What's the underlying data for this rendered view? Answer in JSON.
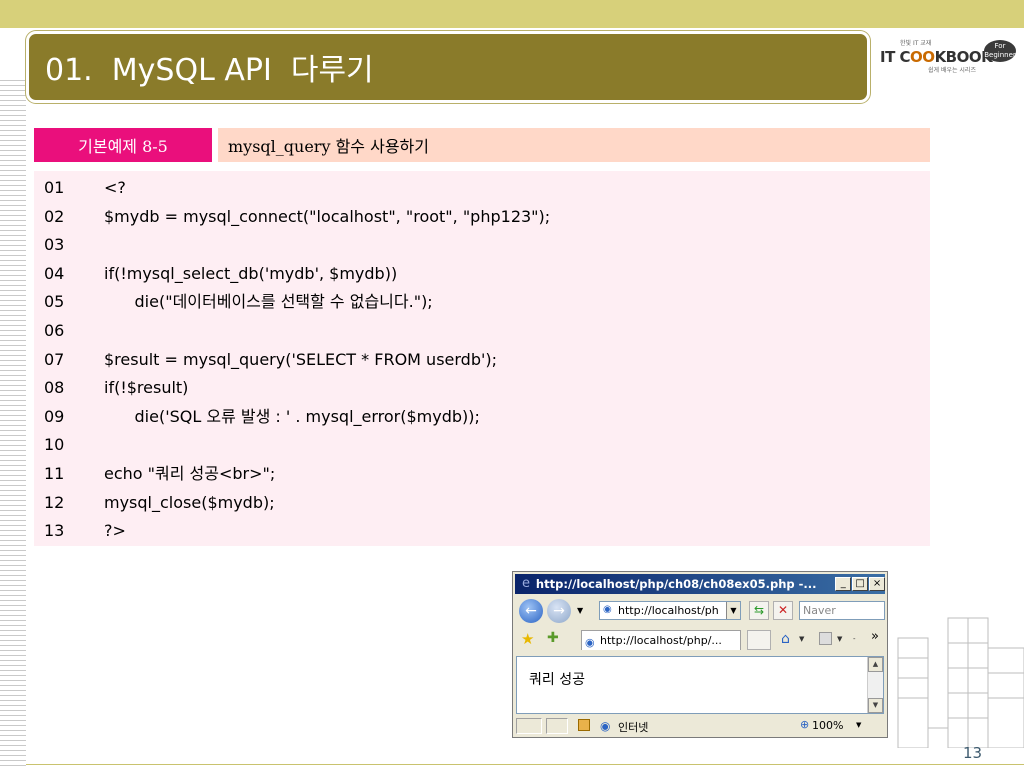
{
  "slide": {
    "title": "01.  MySQL API  다루기",
    "page_number": "13"
  },
  "logo": {
    "brand_prefix": "IT C",
    "brand_oo": "OO",
    "brand_suffix": "KBOOK",
    "tagline": "한빛 IT 교재",
    "sub": "쉽게 배우는 시리즈",
    "badge": "For Beginner"
  },
  "example": {
    "label": "기본예제 8-5",
    "title": "mysql_query 함수 사용하기"
  },
  "code_lines": [
    {
      "no": "01",
      "code": "<?"
    },
    {
      "no": "02",
      "code": "$mydb = mysql_connect(\"localhost\", \"root\", \"php123\");"
    },
    {
      "no": "03",
      "code": ""
    },
    {
      "no": "04",
      "code": "if(!mysql_select_db('mydb', $mydb))"
    },
    {
      "no": "05",
      "code": "      die(\"데이터베이스를 선택할 수 없습니다.\");"
    },
    {
      "no": "06",
      "code": ""
    },
    {
      "no": "07",
      "code": "$result = mysql_query('SELECT * FROM userdb');"
    },
    {
      "no": "08",
      "code": "if(!$result)"
    },
    {
      "no": "09",
      "code": "      die('SQL 오류 발생 : ' . mysql_error($mydb));"
    },
    {
      "no": "10",
      "code": ""
    },
    {
      "no": "11",
      "code": "echo \"쿼리 성공<br>\";"
    },
    {
      "no": "12",
      "code": "mysql_close($mydb);"
    },
    {
      "no": "13",
      "code": "?>"
    }
  ],
  "browser": {
    "title": "http://localhost/php/ch08/ch08ex05.php -...",
    "minimize": "_",
    "maximize": "□",
    "close": "×",
    "address": "http://localhost/ph",
    "search_placeholder": "Naver",
    "tab_title": "http://localhost/php/...",
    "content": "쿼리 성공",
    "status_zone": "인터넷",
    "zoom": "100%",
    "chevron": "»"
  },
  "colors": {
    "title_bg": "#8a7b2a",
    "example_label_bg": "#ea0f7c",
    "example_title_bg": "#ffd8c8",
    "code_bg": "#feeef3"
  }
}
